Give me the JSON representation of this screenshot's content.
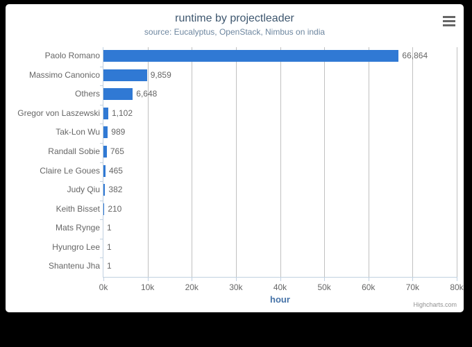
{
  "chart_data": {
    "type": "bar",
    "orientation": "horizontal",
    "title": "runtime by projectleader",
    "subtitle": "source: Eucalyptus, OpenStack, Nimbus on india",
    "xlabel": "hour",
    "ylabel": "",
    "xlim": [
      0,
      80000
    ],
    "xticks": [
      0,
      10000,
      20000,
      30000,
      40000,
      50000,
      60000,
      70000,
      80000
    ],
    "xtick_labels": [
      "0k",
      "10k",
      "20k",
      "30k",
      "40k",
      "50k",
      "60k",
      "70k",
      "80k"
    ],
    "grid": true,
    "grid_axis": "x",
    "legend": false,
    "categories": [
      "Paolo Romano",
      "Massimo Canonico",
      "Others",
      "Gregor von Laszewski",
      "Tak-Lon Wu",
      "Randall Sobie",
      "Claire Le Goues",
      "Judy Qiu",
      "Keith Bisset",
      "Mats Rynge",
      "Hyungro Lee",
      "Shantenu Jha"
    ],
    "values": [
      66864,
      9859,
      6648,
      1102,
      989,
      765,
      465,
      382,
      210,
      1,
      1,
      1
    ],
    "data_labels": [
      "66,864",
      "9,859",
      "6,648",
      "1,102",
      "989",
      "765",
      "465",
      "382",
      "210",
      "1",
      "1",
      "1"
    ],
    "series_color": "#3079d4"
  },
  "toolbar": {
    "context_menu_label": "hamburger-menu"
  },
  "credits": {
    "text": "Highcharts.com"
  },
  "colors": {
    "bar": "#3079d4",
    "title": "#3E576F",
    "subtitle": "#6D869F",
    "axis_title": "#4572A7",
    "tick_text": "#666666",
    "gridline": "#C0C0C0",
    "axis_line": "#C0D0E0",
    "background": "#ffffff",
    "page_background": "#000000"
  }
}
